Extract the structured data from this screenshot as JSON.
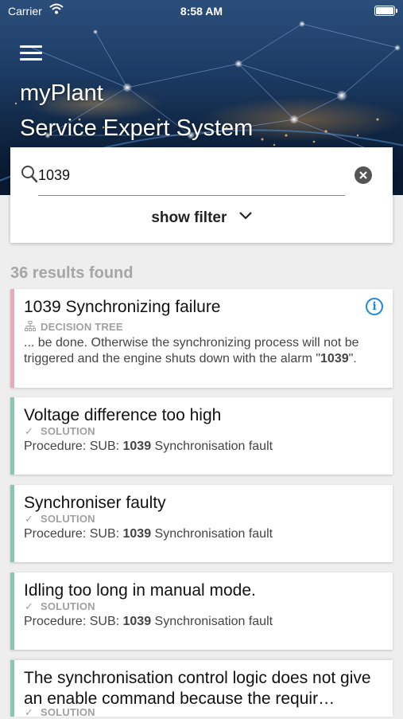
{
  "status_bar": {
    "carrier": "Carrier",
    "time": "8:58 AM"
  },
  "header": {
    "title_line1": "myPlant",
    "title_line2": "Service Expert System"
  },
  "search": {
    "value": "1039",
    "filter_label": "show filter"
  },
  "results": {
    "count_label": "36 results found",
    "items": [
      {
        "title": "1039 Synchronizing failure",
        "type": "DECISION TREE",
        "desc_pre": "... be done. Otherwise the synchronizing process will not be triggered and the engine shuts down with the alarm \"",
        "desc_bold": "1039",
        "desc_post": "\"."
      },
      {
        "title": "Voltage difference too high",
        "type": "SOLUTION",
        "desc_pre": "Procedure: SUB: ",
        "desc_bold": "1039",
        "desc_post": " Synchronisation fault"
      },
      {
        "title": "Synchroniser faulty",
        "type": "SOLUTION",
        "desc_pre": "Procedure: SUB: ",
        "desc_bold": "1039",
        "desc_post": " Synchronisation fault"
      },
      {
        "title": "Idling too long in manual mode.",
        "type": "SOLUTION",
        "desc_pre": "Procedure: SUB: ",
        "desc_bold": "1039",
        "desc_post": " Synchronisation fault"
      },
      {
        "title": "The synchronisation control logic does not give an enable command because the requir…",
        "type": "SOLUTION"
      }
    ]
  },
  "colors": {
    "tree_accent": "#f0a7b6",
    "solution_accent": "#7fcbb5",
    "info_blue": "#1e88d8"
  }
}
